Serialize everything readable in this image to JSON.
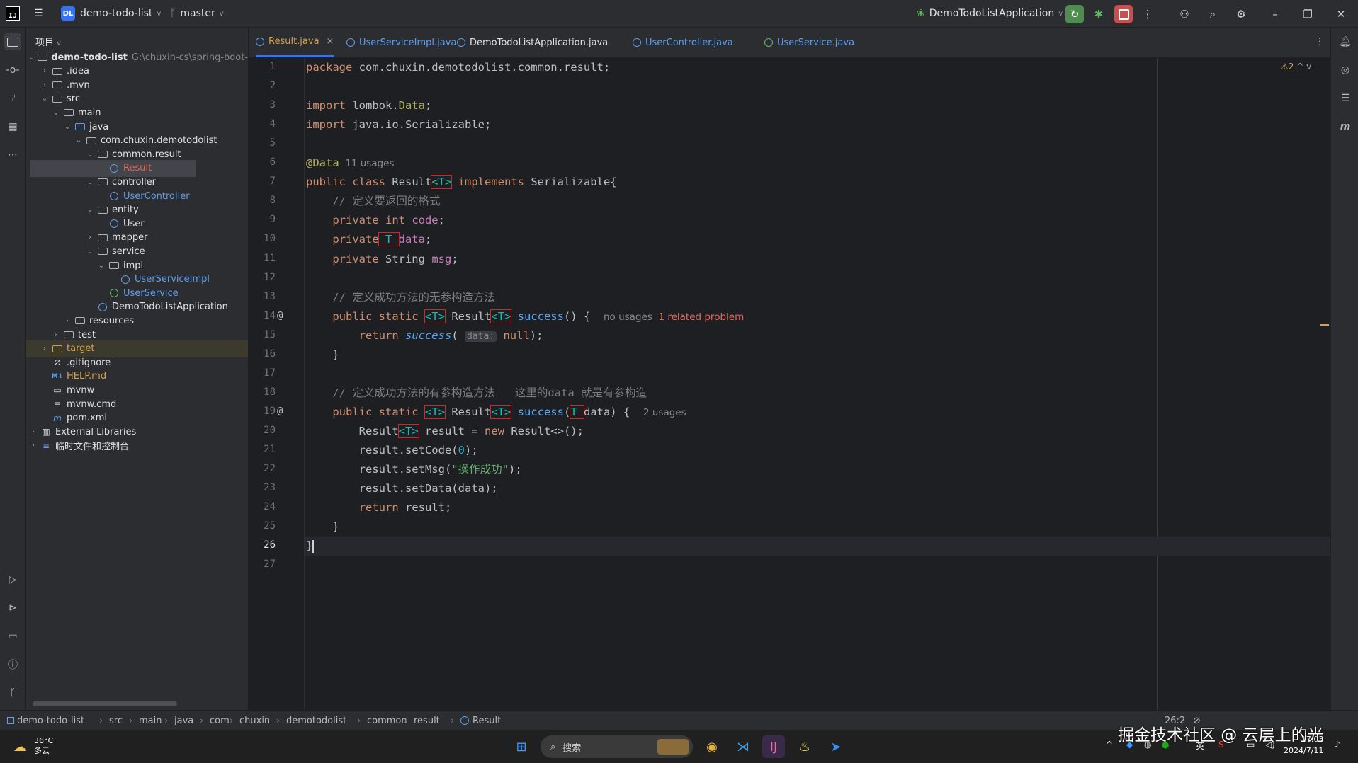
{
  "titlebar": {
    "project_badge": "DL",
    "project_name": "demo-todo-list",
    "branch": "master",
    "run_config": "DemoTodoListApplication"
  },
  "project_panel": {
    "header": "项目",
    "tree": [
      {
        "label": "demo-todo-list",
        "path": "G:\\chuxin-cs\\spring-boot-",
        "depth": 0,
        "chev": "v",
        "icon": "module",
        "style": "bold"
      },
      {
        "label": ".idea",
        "depth": 1,
        "chev": ">",
        "icon": "folder"
      },
      {
        "label": ".mvn",
        "depth": 1,
        "chev": ">",
        "icon": "folder"
      },
      {
        "label": "src",
        "depth": 1,
        "chev": "v",
        "icon": "folder"
      },
      {
        "label": "main",
        "depth": 2,
        "chev": "v",
        "icon": "folder"
      },
      {
        "label": "java",
        "depth": 3,
        "chev": "v",
        "icon": "srcfolder"
      },
      {
        "label": "com.chuxin.demotodolist",
        "depth": 4,
        "chev": "v",
        "icon": "package"
      },
      {
        "label": "common.result",
        "depth": 5,
        "chev": "v",
        "icon": "package"
      },
      {
        "label": "Result",
        "depth": 6,
        "chev": "",
        "icon": "class",
        "style": "selected-red"
      },
      {
        "label": "controller",
        "depth": 5,
        "chev": "v",
        "icon": "package"
      },
      {
        "label": "UserController",
        "depth": 6,
        "chev": "",
        "icon": "class",
        "style": "blue"
      },
      {
        "label": "entity",
        "depth": 5,
        "chev": "v",
        "icon": "package"
      },
      {
        "label": "User",
        "depth": 6,
        "chev": "",
        "icon": "class"
      },
      {
        "label": "mapper",
        "depth": 5,
        "chev": ">",
        "icon": "package"
      },
      {
        "label": "service",
        "depth": 5,
        "chev": "v",
        "icon": "package"
      },
      {
        "label": "impl",
        "depth": 6,
        "chev": "v",
        "icon": "package"
      },
      {
        "label": "UserServiceImpl",
        "depth": 7,
        "chev": "",
        "icon": "class",
        "style": "blue"
      },
      {
        "label": "UserService",
        "depth": 6,
        "chev": "",
        "icon": "interface",
        "style": "blue"
      },
      {
        "label": "DemoTodoListApplication",
        "depth": 5,
        "chev": "",
        "icon": "app"
      },
      {
        "label": "resources",
        "depth": 3,
        "chev": ">",
        "icon": "folder"
      },
      {
        "label": "test",
        "depth": 2,
        "chev": ">",
        "icon": "folder"
      },
      {
        "label": "target",
        "depth": 1,
        "chev": ">",
        "icon": "folder-yellow",
        "style": "excluded"
      },
      {
        "label": ".gitignore",
        "depth": 1,
        "chev": "",
        "icon": "ignore"
      },
      {
        "label": "HELP.md",
        "depth": 1,
        "chev": "",
        "icon": "md",
        "style": "yellow"
      },
      {
        "label": "mvnw",
        "depth": 1,
        "chev": "",
        "icon": "file"
      },
      {
        "label": "mvnw.cmd",
        "depth": 1,
        "chev": "",
        "icon": "lines"
      },
      {
        "label": "pom.xml",
        "depth": 1,
        "chev": "",
        "icon": "maven"
      },
      {
        "label": "External Libraries",
        "depth": 0,
        "chev": ">",
        "icon": "lib"
      },
      {
        "label": "临时文件和控制台",
        "depth": 0,
        "chev": ">",
        "icon": "scratch"
      }
    ]
  },
  "tabs": [
    {
      "label": "Result.java",
      "icon": "class",
      "active": true
    },
    {
      "label": "UserServiceImpl.java",
      "icon": "class"
    },
    {
      "label": "DemoTodoListApplication.java",
      "icon": "app"
    },
    {
      "label": "UserController.java",
      "icon": "class"
    },
    {
      "label": "UserService.java",
      "icon": "interface"
    }
  ],
  "editor": {
    "warnings": "⚠2",
    "current_line": 26,
    "lines": [
      [
        [
          "kw",
          "package "
        ],
        [
          "",
          "com.chuxin.demotodolist.common.result;"
        ]
      ],
      [],
      [
        [
          "kw",
          "import "
        ],
        [
          "",
          "lombok."
        ],
        [
          "ann",
          "Data"
        ],
        [
          "",
          ";"
        ]
      ],
      [
        [
          "kw",
          "import "
        ],
        [
          "",
          "java.io.Serializable;"
        ]
      ],
      [],
      [
        [
          "ann",
          "@Data"
        ],
        [
          "hint",
          "  11 usages"
        ]
      ],
      [
        [
          "kw",
          "public class "
        ],
        [
          "",
          "Result"
        ],
        [
          "tpb",
          "<T>"
        ],
        [
          "kw",
          " implements "
        ],
        [
          "",
          "Serializable{"
        ]
      ],
      [
        [
          "cm",
          "    // 定义要返回的格式"
        ]
      ],
      [
        [
          "kw",
          "    private int "
        ],
        [
          "fld",
          "code"
        ],
        [
          "",
          ";"
        ]
      ],
      [
        [
          "kw",
          "    private"
        ],
        [
          "tpb",
          " T "
        ],
        [
          "fld",
          "data"
        ],
        [
          "",
          ";"
        ]
      ],
      [
        [
          "kw",
          "    private "
        ],
        [
          "",
          "String "
        ],
        [
          "fld",
          "msg"
        ],
        [
          "",
          ";"
        ]
      ],
      [],
      [
        [
          "cm",
          "    // 定义成功方法的无参构造方法"
        ]
      ],
      [
        [
          "kw",
          "    public static "
        ],
        [
          "tpb",
          "<T>"
        ],
        [
          "",
          " Result"
        ],
        [
          "tpb",
          "<T>"
        ],
        [
          "fn",
          " success"
        ],
        [
          "",
          "() {  "
        ],
        [
          "hint",
          "no usages"
        ],
        [
          "prob",
          "  1 related problem"
        ]
      ],
      [
        [
          "kw",
          "        return "
        ],
        [
          "fni",
          "success"
        ],
        [
          "",
          "( "
        ],
        [
          "param",
          "data:"
        ],
        [
          "kw",
          " null"
        ],
        [
          "",
          ");"
        ]
      ],
      [
        [
          "",
          "    }"
        ]
      ],
      [],
      [
        [
          "cm",
          "    // 定义成功方法的有参构造方法   这里的data 就是有参构造"
        ]
      ],
      [
        [
          "kw",
          "    public static "
        ],
        [
          "tpb",
          "<T>"
        ],
        [
          "",
          " Result"
        ],
        [
          "tpb",
          "<T>"
        ],
        [
          "fn",
          " success"
        ],
        [
          "",
          "("
        ],
        [
          "tpb",
          "T "
        ],
        [
          "",
          "data) {  "
        ],
        [
          "hint",
          "2 usages"
        ]
      ],
      [
        [
          "",
          "        Result"
        ],
        [
          "tpb",
          "<T>"
        ],
        [
          "",
          " result = "
        ],
        [
          "kw",
          "new "
        ],
        [
          "",
          "Result<>();"
        ]
      ],
      [
        [
          "",
          "        result.setCode("
        ],
        [
          "num",
          "0"
        ],
        [
          "",
          ");"
        ]
      ],
      [
        [
          "",
          "        result.setMsg("
        ],
        [
          "str",
          "\"操作成功\""
        ],
        [
          "",
          ");"
        ]
      ],
      [
        [
          "",
          "        result.setData(data);"
        ]
      ],
      [
        [
          "kw",
          "        return "
        ],
        [
          "",
          "result;"
        ]
      ],
      [
        [
          "",
          "    }"
        ]
      ],
      [
        [
          "",
          "}"
        ]
      ],
      []
    ]
  },
  "statusbar": {
    "crumbs": [
      "demo-todo-list",
      "src",
      "main",
      "java",
      "com",
      "chuxin",
      "demotodolist",
      "common",
      "result",
      "Result"
    ],
    "position": "26:2"
  },
  "taskbar": {
    "weather_temp": "36°C",
    "weather_desc": "多云",
    "search_placeholder": "搜索",
    "ime": "英",
    "time": "17:03",
    "date": "2024/7/11"
  },
  "watermark": "掘金技术社区 @ 云层上的光",
  "colors": {
    "accent": "#3574f0",
    "box": "#e0211d",
    "bg": "#1e1f22",
    "panel": "#2b2d30"
  }
}
